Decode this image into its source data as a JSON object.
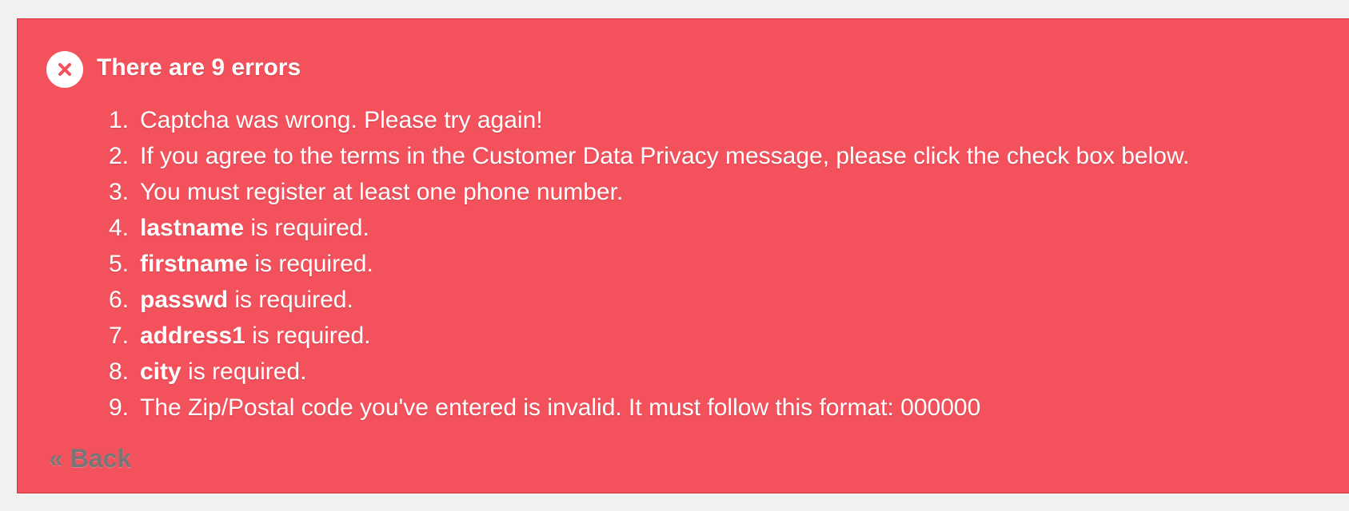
{
  "alert": {
    "type": "error",
    "title": "There are 9 errors",
    "icon": "close-circle-icon",
    "colors": {
      "background": "#f3515c",
      "border": "#d4323e",
      "text": "#ffffff",
      "back_link": "#777777",
      "page_background": "#f1f1f1"
    },
    "errors": [
      {
        "number": "1.",
        "field": "",
        "message": "Captcha was wrong. Please try again!"
      },
      {
        "number": "2.",
        "field": "",
        "message": "If you agree to the terms in the Customer Data Privacy message, please click the check box below."
      },
      {
        "number": "3.",
        "field": "",
        "message": "You must register at least one phone number."
      },
      {
        "number": "4.",
        "field": "lastname",
        "message": " is required."
      },
      {
        "number": "5.",
        "field": "firstname",
        "message": " is required."
      },
      {
        "number": "6.",
        "field": "passwd",
        "message": " is required."
      },
      {
        "number": "7.",
        "field": "address1",
        "message": " is required."
      },
      {
        "number": "8.",
        "field": "city",
        "message": " is required."
      },
      {
        "number": "9.",
        "field": "",
        "message": "The Zip/Postal code you've entered is invalid. It must follow this format: 000000"
      }
    ],
    "back_label": "« Back"
  }
}
